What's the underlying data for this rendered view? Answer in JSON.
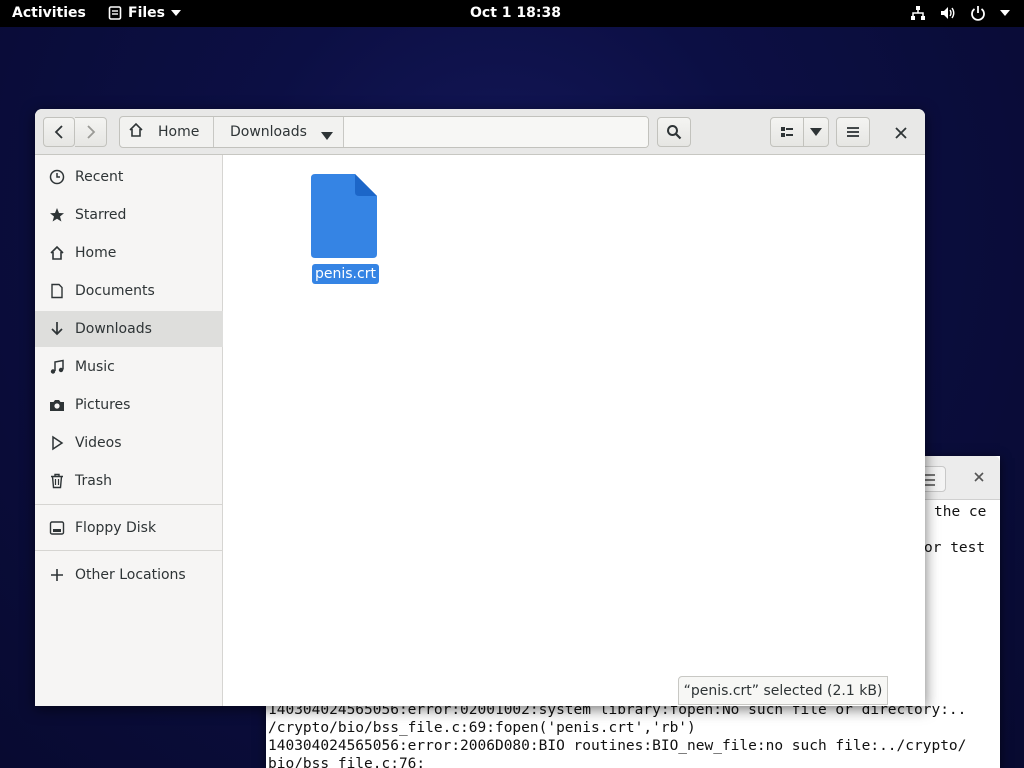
{
  "topbar": {
    "activities": "Activities",
    "app_menu": "Files",
    "clock": "Oct 1  18:38"
  },
  "file_manager": {
    "pathbar": {
      "home": "Home",
      "current": "Downloads"
    },
    "sidebar": {
      "items": [
        {
          "label": "Recent",
          "icon": "clock-icon"
        },
        {
          "label": "Starred",
          "icon": "star-icon"
        },
        {
          "label": "Home",
          "icon": "home-icon"
        },
        {
          "label": "Documents",
          "icon": "document-icon"
        },
        {
          "label": "Downloads",
          "icon": "download-icon",
          "active": true
        },
        {
          "label": "Music",
          "icon": "music-icon"
        },
        {
          "label": "Pictures",
          "icon": "camera-icon"
        },
        {
          "label": "Videos",
          "icon": "video-icon"
        },
        {
          "label": "Trash",
          "icon": "trash-icon"
        },
        {
          "label": "Floppy Disk",
          "icon": "disk-icon"
        },
        {
          "label": "Other Locations",
          "icon": "plus-icon"
        }
      ]
    },
    "files": [
      {
        "name": "penis.crt",
        "selected": true
      }
    ],
    "status": "“penis.crt” selected  (2.1 kB)",
    "accent_color": "#3584e4"
  },
  "terminal": {
    "lines_right": [
      "the ce",
      "or test"
    ],
    "lines_bottom": [
      "140304024565056:error:02001002:system library:fopen:No such file or directory:..",
      "/crypto/bio/bss_file.c:69:fopen('penis.crt','rb')",
      "140304024565056:error:2006D080:BIO routines:BIO_new_file:no such file:../crypto/",
      "bio/bss_file.c:76:"
    ]
  }
}
